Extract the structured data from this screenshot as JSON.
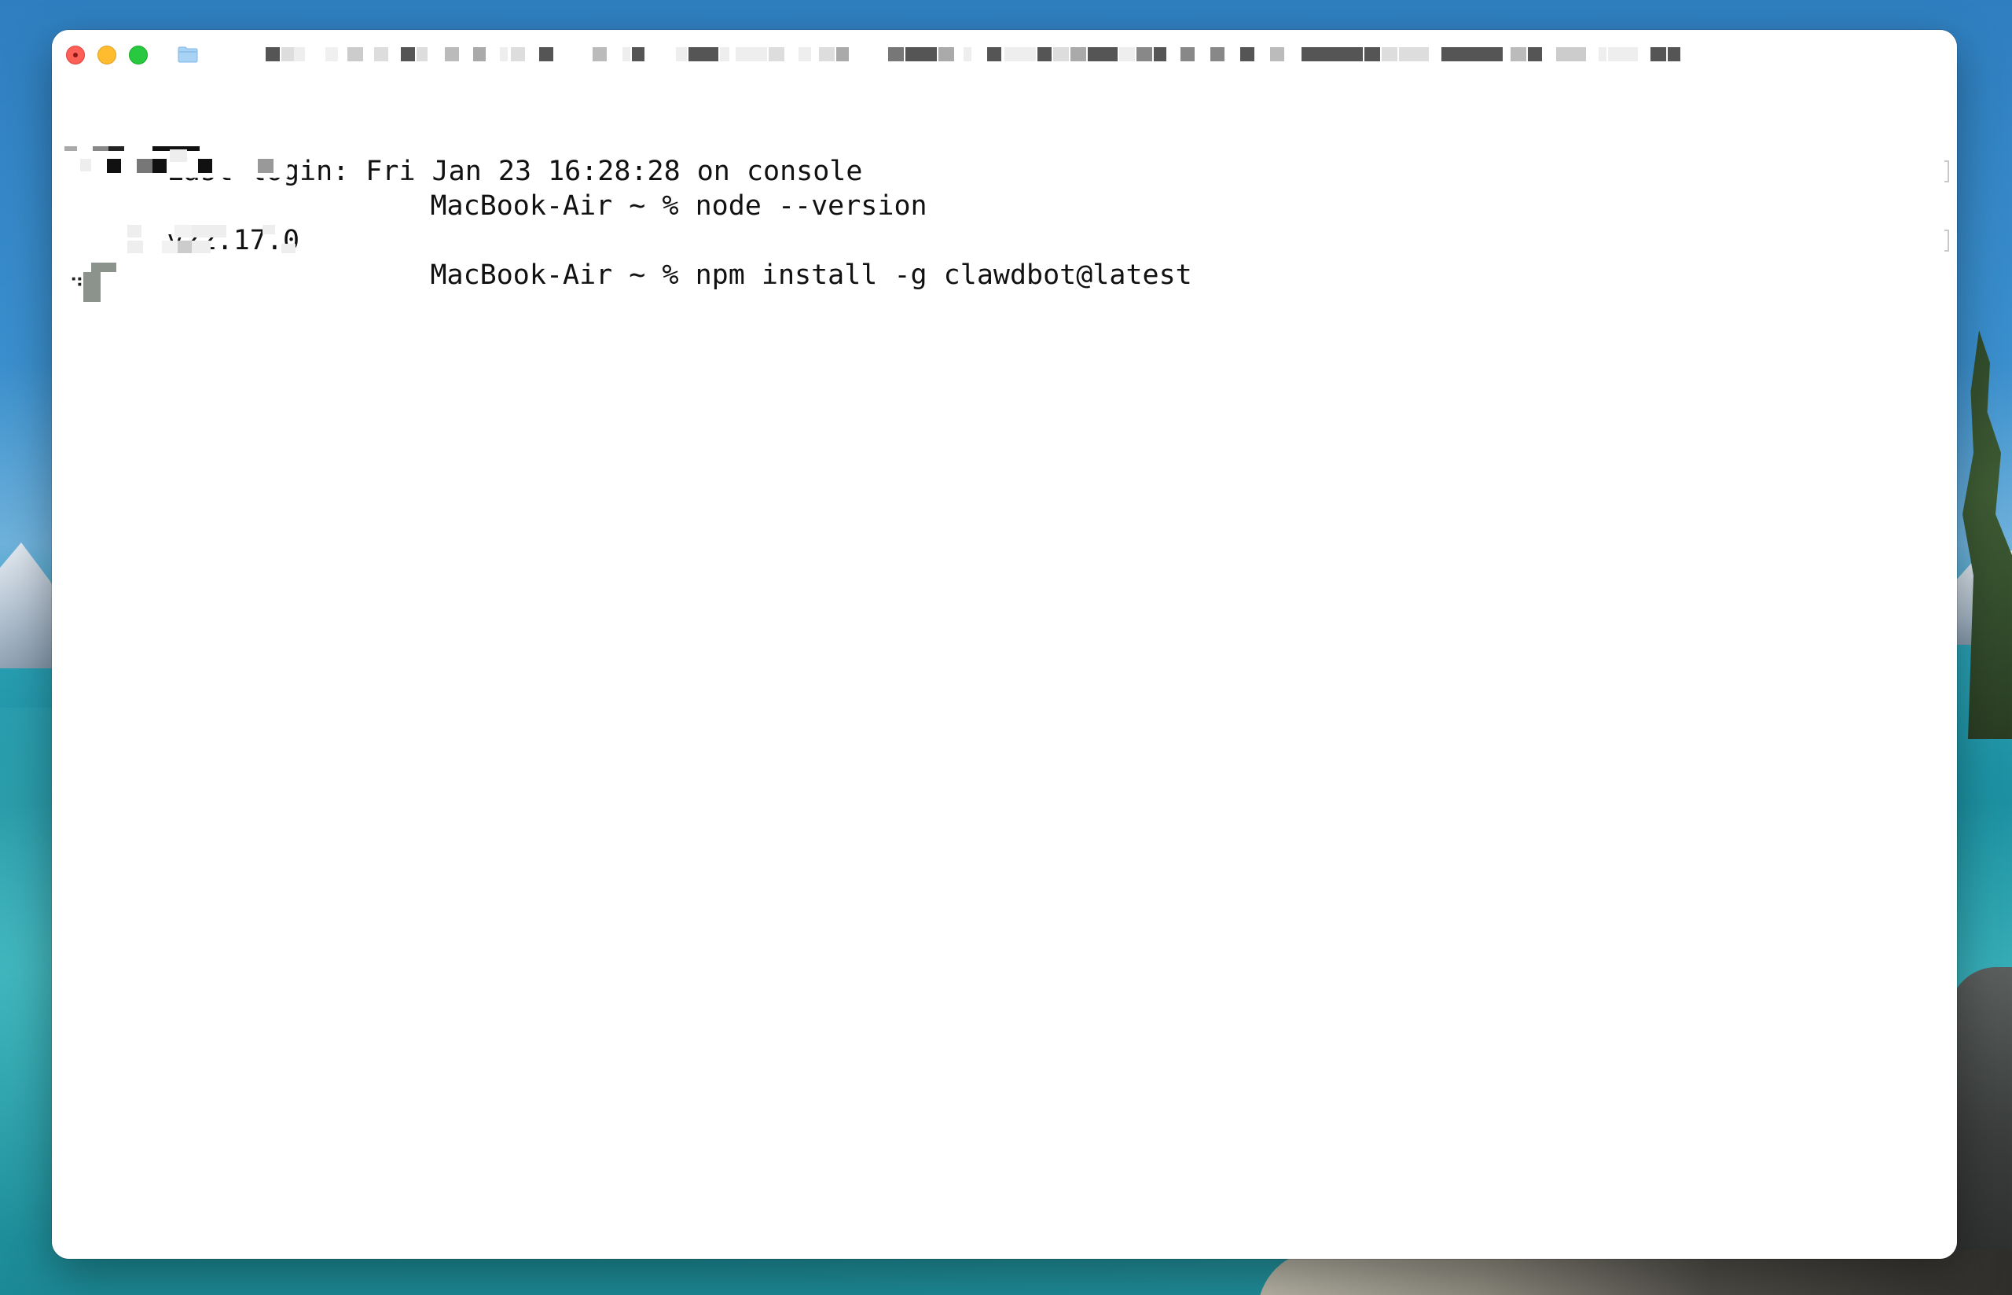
{
  "window": {
    "title_redacted": true
  },
  "terminal": {
    "lines": [
      {
        "text": "Last login: Fri Jan 23 16:28:28 on console"
      },
      {
        "prompt_suffix": "MacBook-Air ~ % ",
        "command": "node --version"
      },
      {
        "text": "v22.17.0"
      },
      {
        "prompt_suffix": "MacBook-Air ~ % ",
        "command": "npm install -g clawdbot@latest"
      }
    ],
    "spinner": "⠙"
  },
  "colors": {
    "close": "#fe5f57",
    "minimize": "#febc2e",
    "maximize": "#28c840",
    "terminal_bg": "#ffffff",
    "terminal_fg": "#111111"
  },
  "icons": {
    "folder": "folder-icon",
    "close": "close-icon",
    "minimize": "minimize-icon",
    "maximize": "maximize-icon"
  }
}
